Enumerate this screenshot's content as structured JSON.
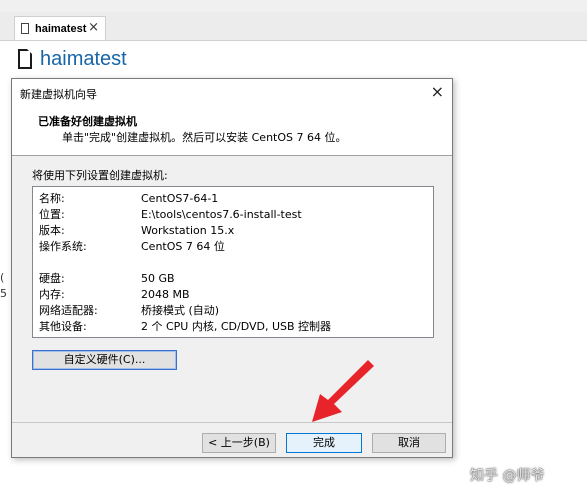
{
  "app": {
    "tab_label": "haimatest",
    "tab_close": "×",
    "vm_title": "haimatest",
    "left_edge_chars": [
      "(",
      "5"
    ]
  },
  "dialog": {
    "title": "新建虚拟机向导",
    "close": "×",
    "heading": "已准备好创建虚拟机",
    "subtitle": "单击\"完成\"创建虚拟机。然后可以安装 CentOS 7 64 位。",
    "group_label": "将使用下列设置创建虚拟机:",
    "summary": [
      {
        "key": "名称:",
        "value": "CentOS7-64-1"
      },
      {
        "key": "位置:",
        "value": "E:\\tools\\centos7.6-install-test"
      },
      {
        "key": "版本:",
        "value": "Workstation 15.x"
      },
      {
        "key": "操作系统:",
        "value": "CentOS 7 64 位"
      },
      {
        "key": "硬盘:",
        "value": "50 GB"
      },
      {
        "key": "内存:",
        "value": "2048 MB"
      },
      {
        "key": "网络适配器:",
        "value": "桥接模式 (自动)"
      },
      {
        "key": "其他设备:",
        "value": "2 个 CPU 内核, CD/DVD, USB 控制器"
      }
    ],
    "buttons": {
      "customize": "自定义硬件(C)...",
      "back": "< 上一步(B)",
      "finish": "完成",
      "cancel": "取消"
    }
  },
  "annotation": {
    "arrow_color": "#e8242b"
  },
  "watermark": "知乎 @师爷"
}
